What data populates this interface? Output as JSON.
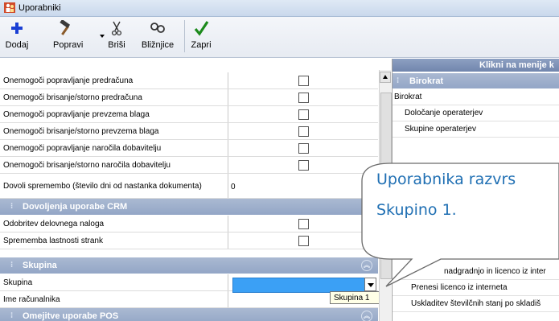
{
  "window": {
    "title": "Uporabniki"
  },
  "toolbar": {
    "add": "Dodaj",
    "edit": "Popravi",
    "delete": "Briši",
    "shortcuts": "Bližnjice",
    "close": "Zapri"
  },
  "grid": {
    "rows": [
      {
        "label": "Onemogoči popravljanje predračuna",
        "checked": false
      },
      {
        "label": "Onemogoči brisanje/storno predračuna",
        "checked": false
      },
      {
        "label": "Onemogoči popravljanje prevzema blaga",
        "checked": false
      },
      {
        "label": "Onemogoči brisanje/storno prevzema blaga",
        "checked": false
      },
      {
        "label": "Onemogoči popravljanje naročila dobavitelju",
        "checked": false
      },
      {
        "label": "Onemogoči brisanje/storno naročila dobavitelju",
        "checked": false
      }
    ],
    "dovoli": {
      "label": "Dovoli spremembo (število dni od nastanka dokumenta)",
      "value": "0"
    },
    "crm_section": "Dovoljenja uporabe CRM",
    "crm_rows": [
      {
        "label": "Odobritev delovnega naloga",
        "checked": false
      },
      {
        "label": "Sprememba lastnosti strank",
        "checked": false
      }
    ],
    "skupina_section": "Skupina",
    "skupina_row": {
      "label": "Skupina",
      "value": ""
    },
    "pc_row": {
      "label": "Ime računalnika"
    },
    "pos_section": "Omejitve uporabe POS",
    "tooltip": "Skupina 1"
  },
  "right_panel": {
    "header": "Klikni na menije k",
    "section": "Birokrat",
    "items": [
      "Birokrat",
      "Določanje operaterjev",
      "Skupine operaterjev",
      "nadgradnjo in licenco iz inter",
      "Prenesi licenco iz interneta",
      "Uskladitev številčnih stanj po skladiš"
    ]
  },
  "callout": {
    "line1": "Uporabnika razvrs",
    "line2": "Skupino 1."
  },
  "colors": {
    "selection": "#3ba0f5",
    "section": "#9aabca",
    "callout_text": "#1f6fb3"
  },
  "icons": {
    "app": "people-icon",
    "add": "plus-icon",
    "edit": "hammer-icon",
    "delete": "scissors-icon",
    "shortcuts": "link-icon",
    "close": "checkmark-icon"
  }
}
